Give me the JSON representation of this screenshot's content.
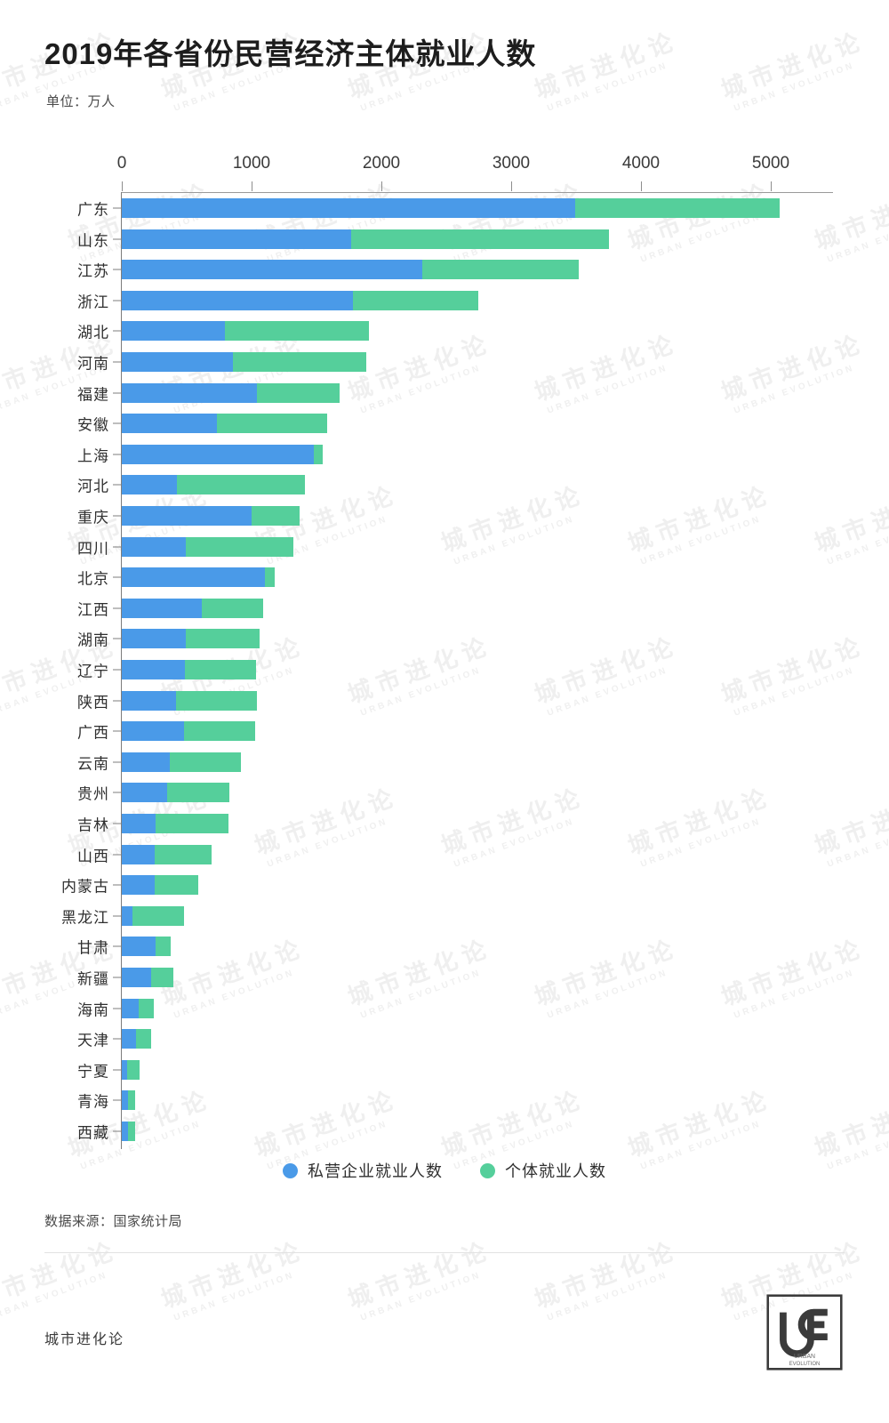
{
  "header": {
    "title": "2019年各省份民营经济主体就业人数",
    "unit": "单位：万人"
  },
  "footer": {
    "source": "数据来源：国家统计局",
    "brand": "城市进化论",
    "logo_alt": "ue-logo-icon"
  },
  "watermark": {
    "cn": "城市进化论",
    "en": "URBAN EVOLUTION"
  },
  "chart_data": {
    "type": "bar",
    "orientation": "horizontal",
    "stacked": true,
    "title": "2019年各省份民营经济主体就业人数",
    "subtitle": "单位：万人",
    "xlabel": "",
    "ylabel": "",
    "unit": "万人",
    "xlim": [
      0,
      5480
    ],
    "xticks": [
      0,
      1000,
      2000,
      3000,
      4000,
      5000
    ],
    "xticklabels": [
      "0",
      "1000",
      "2000",
      "3000",
      "4000",
      "5000"
    ],
    "grid": false,
    "legend_position": "bottom",
    "colors": [
      "#4a9ae8",
      "#55cf9b"
    ],
    "series": [
      {
        "name": "私营企业就业人数",
        "color": "#4a9ae8",
        "values": [
          3493,
          1767,
          2315,
          1780,
          795,
          856,
          1041,
          733,
          1480,
          425,
          1000,
          493,
          1103,
          616,
          490,
          486,
          420,
          480,
          370,
          350,
          260,
          250,
          250,
          80,
          260,
          225,
          130,
          110,
          40,
          45,
          45
        ]
      },
      {
        "name": "个体就业人数",
        "color": "#55cf9b",
        "values": [
          1575,
          1986,
          1205,
          970,
          1109,
          1028,
          637,
          849,
          68,
          986,
          370,
          829,
          75,
          473,
          575,
          545,
          620,
          545,
          545,
          480,
          560,
          440,
          340,
          400,
          120,
          170,
          115,
          115,
          100,
          60,
          55
        ]
      }
    ],
    "categories": [
      "广东",
      "山东",
      "江苏",
      "浙江",
      "湖北",
      "河南",
      "福建",
      "安徽",
      "上海",
      "河北",
      "重庆",
      "四川",
      "北京",
      "江西",
      "湖南",
      "辽宁",
      "陕西",
      "广西",
      "云南",
      "贵州",
      "吉林",
      "山西",
      "内蒙古",
      "黑龙江",
      "甘肃",
      "新疆",
      "海南",
      "天津",
      "宁夏",
      "青海",
      "西藏"
    ]
  }
}
